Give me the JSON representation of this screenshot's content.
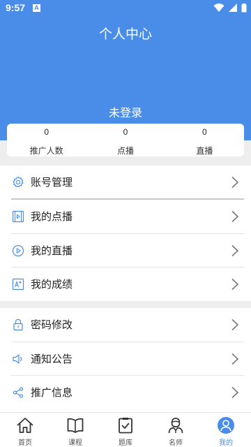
{
  "status_bar": {
    "time": "9:57",
    "notification_icon": "a-square-icon"
  },
  "header": {
    "title": "个人中心",
    "login_status": "未登录"
  },
  "stats": [
    {
      "value": "0",
      "label": "推广人数"
    },
    {
      "value": "0",
      "label": "点播"
    },
    {
      "value": "0",
      "label": "直播"
    }
  ],
  "menu": {
    "group1": [
      {
        "label": "账号管理",
        "icon": "gear-icon"
      },
      {
        "label": "我的点播",
        "icon": "film-icon"
      },
      {
        "label": "我的直播",
        "icon": "play-circle-icon"
      },
      {
        "label": "我的成绩",
        "icon": "score-icon"
      }
    ],
    "group2": [
      {
        "label": "密码修改",
        "icon": "lock-icon"
      },
      {
        "label": "通知公告",
        "icon": "speaker-icon"
      },
      {
        "label": "推广信息",
        "icon": "share-icon"
      }
    ]
  },
  "bottom_nav": [
    {
      "label": "首页",
      "icon": "home-icon"
    },
    {
      "label": "课程",
      "icon": "book-icon"
    },
    {
      "label": "题库",
      "icon": "clipboard-check-icon"
    },
    {
      "label": "名师",
      "icon": "teacher-icon"
    },
    {
      "label": "我的",
      "icon": "profile-icon",
      "active": true
    }
  ],
  "colors": {
    "primary": "#4a8de8",
    "background_band": "#eeeeee"
  }
}
